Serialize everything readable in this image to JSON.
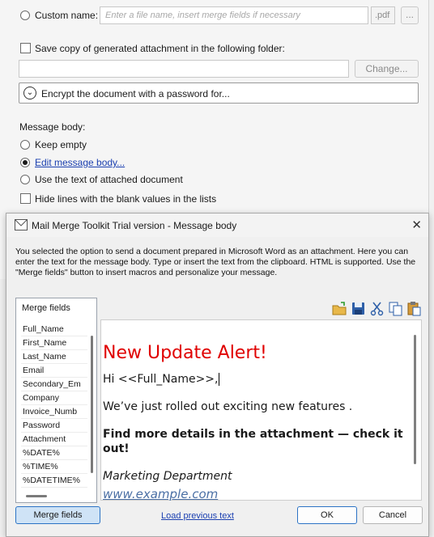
{
  "background_dialog": {
    "custom_name_label": "Custom name:",
    "custom_name_placeholder": "Enter a file name, insert merge fields if necessary",
    "extension": ".pdf",
    "browse_label": "...",
    "save_copy_label": "Save copy of generated attachment in the following folder:",
    "change_label": "Change...",
    "encrypt_label": "Encrypt the document with a password for...",
    "message_body_heading": "Message body:",
    "keep_empty_label": "Keep empty",
    "edit_body_label": "Edit message body...",
    "use_text_label": "Use the text of attached document",
    "hide_lines_label": "Hide lines with the blank values in the lists"
  },
  "modal": {
    "title": "Mail Merge Toolkit Trial version - Message body",
    "close_glyph": "✕",
    "description": "You selected the option to send a document prepared in Microsoft Word as an attachment. Here you can enter the text for the message body. Type or insert the text from the clipboard. HTML is supported. Use the \"Merge fields\" button to insert macros and personalize your message.",
    "list_header": "Merge fields",
    "merge_fields": [
      "Full_Name",
      "First_Name",
      "Last_Name",
      "Email",
      "Secondary_Em",
      "Company",
      "Invoice_Numb",
      "Password",
      "Attachment",
      "%DATE%",
      "%TIME%",
      "%DATETIME%"
    ],
    "toolbar_icons": [
      "open-folder-icon",
      "save-icon",
      "cut-icon",
      "copy-icon",
      "paste-icon"
    ],
    "editor": {
      "heading": "New Update Alert!",
      "greeting": "Hi <<Full_Name>>,",
      "line1": "We’ve just rolled out exciting new features .",
      "line2": "Find more details in the attachment — check it out!",
      "signature": "Marketing Department",
      "link": "www.example.com",
      "heading_color": "#e00000"
    },
    "merge_fields_button": "Merge fields",
    "load_previous": "Load previous text",
    "ok": "OK",
    "cancel": "Cancel"
  },
  "colors": {
    "accent": "#2c73c5",
    "link": "#1a3fb0"
  }
}
